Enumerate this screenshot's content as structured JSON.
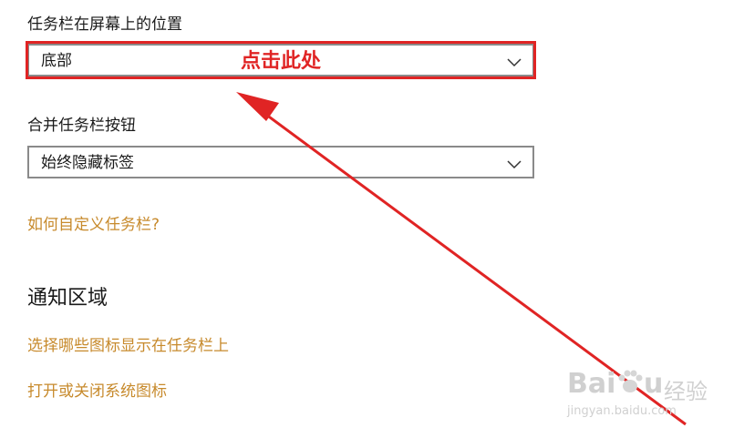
{
  "taskbar_position": {
    "label": "任务栏在屏幕上的位置",
    "selected": "底部"
  },
  "combine_buttons": {
    "label": "合并任务栏按钮",
    "selected": "始终隐藏标签"
  },
  "links": {
    "customize": "如何自定义任务栏?",
    "select_icons": "选择哪些图标显示在任务栏上",
    "system_icons": "打开或关闭系统图标"
  },
  "notification_area": {
    "title": "通知区域"
  },
  "annotation": {
    "text": "点击此处",
    "color": "#e02424"
  },
  "watermark": {
    "brand_latin": "Bai",
    "brand_suffix": "u",
    "brand_cn": "经验",
    "url": "jingyan.baidu.com"
  },
  "colors": {
    "link": "#c78a2c",
    "highlight": "#e02424",
    "dropdown_border": "#8a8a8a"
  }
}
